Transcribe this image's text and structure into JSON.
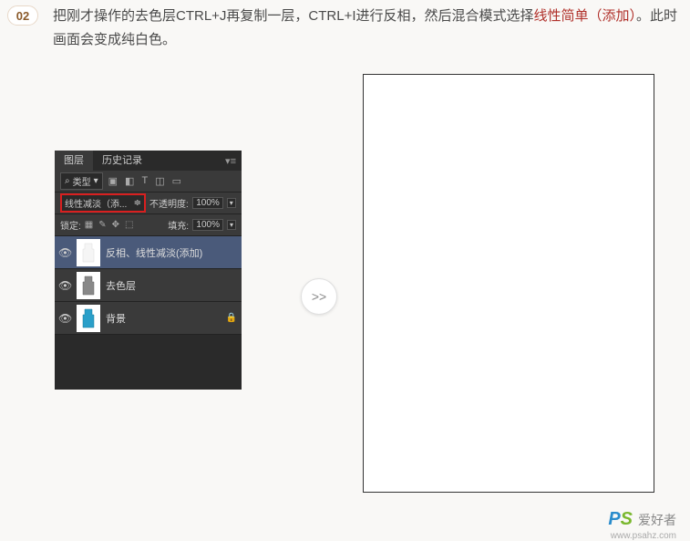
{
  "step": "02",
  "instruction": {
    "part1": "把刚才操作的去色层CTRL+J再复制一层，CTRL+I进行反相，然后混合模式选择",
    "hl1": "线性简单（添加）",
    "part2": "。此时画面会变成纯白色。"
  },
  "panel": {
    "tabs": {
      "layers": "图层",
      "history": "历史记录"
    },
    "menu": "▾≡",
    "filter": {
      "label": "类型",
      "arrow": "⇄"
    },
    "icons": {
      "i1": "▣",
      "i2": "◧",
      "i3": "T",
      "i4": "◫",
      "i5": "▭"
    },
    "blend": {
      "mode": "线性减淡（添...",
      "arrow": "≑",
      "opacity_label": "不透明度:",
      "opacity": "100%"
    },
    "lock": {
      "label": "锁定:",
      "fill_label": "填充:",
      "fill": "100%"
    },
    "lock_icons": {
      "i1": "▦",
      "i2": "✎",
      "i3": "✥",
      "i4": "⬚"
    },
    "layers": [
      {
        "name": "反相、线性减淡(添加)",
        "selected": true,
        "thumb": "white",
        "locked": false
      },
      {
        "name": "去色层",
        "selected": false,
        "thumb": "gray",
        "locked": false
      },
      {
        "name": "背景",
        "selected": false,
        "thumb": "color",
        "locked": true
      }
    ],
    "eye": "👁",
    "lock_icon": "🔒",
    "down": "▾"
  },
  "arrow": ">>",
  "watermark": {
    "p": "P",
    "s": "S",
    "text": "爱好者",
    "url": "www.psahz.com"
  }
}
